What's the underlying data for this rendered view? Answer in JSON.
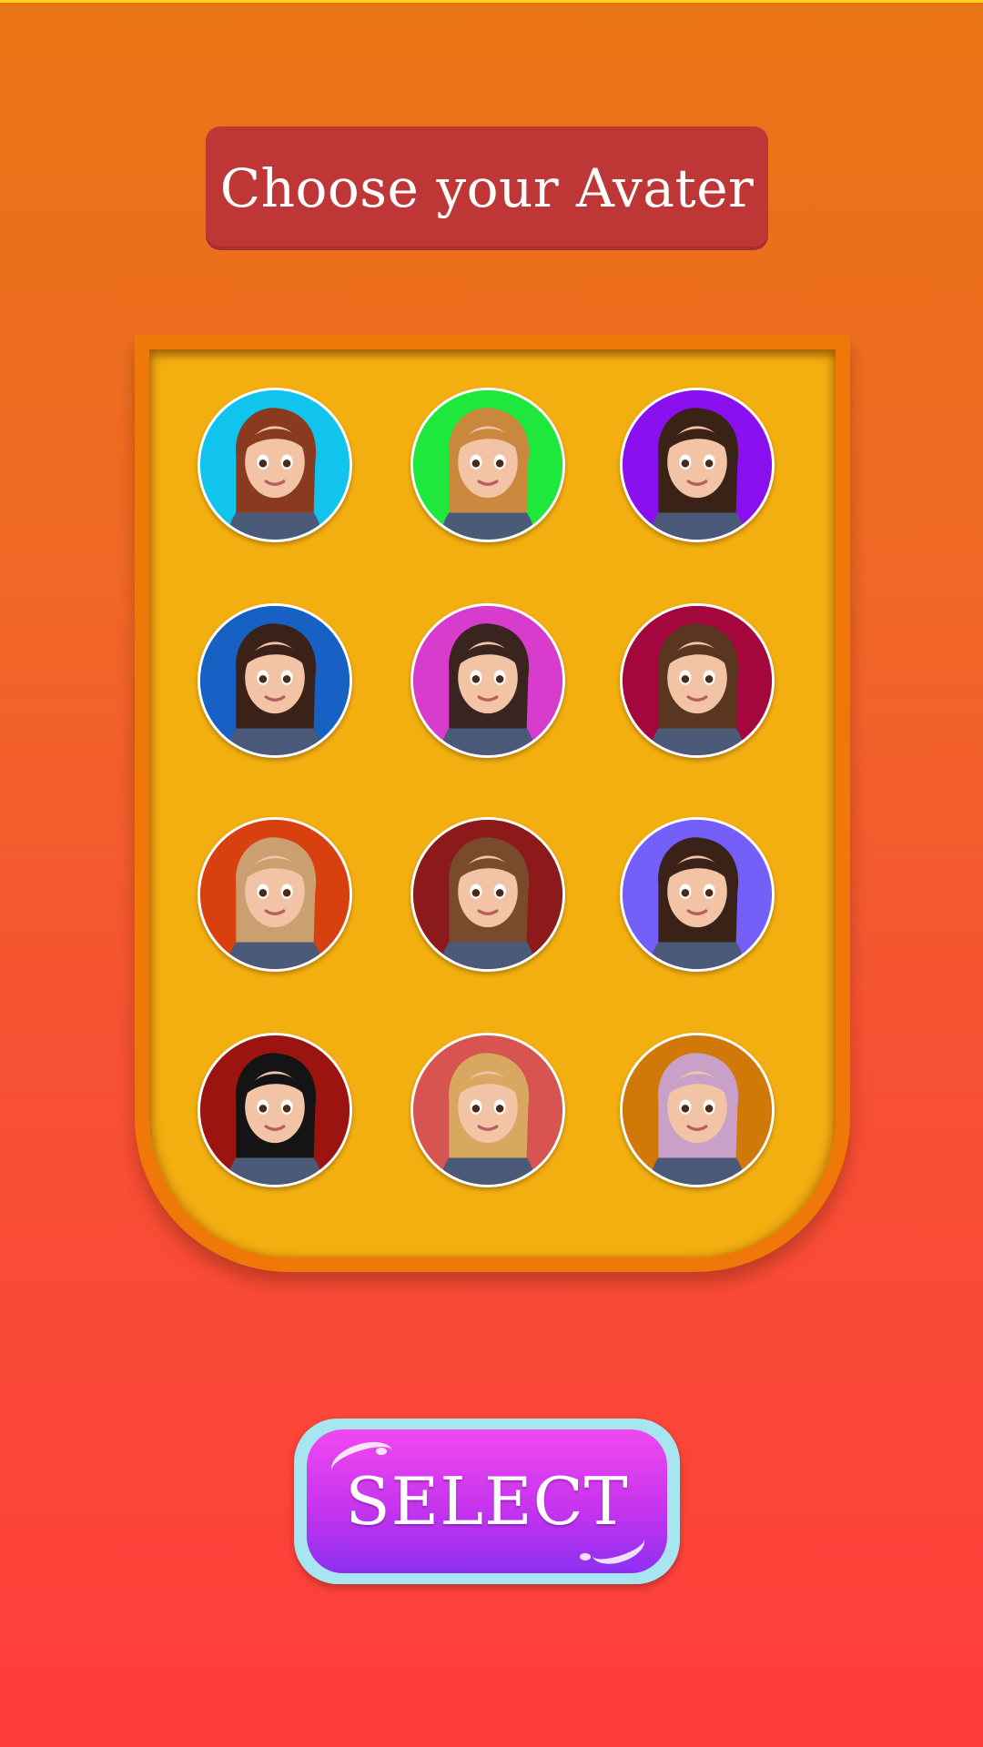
{
  "header": {
    "title": "Choose your Avater"
  },
  "avatars": [
    {
      "icon": "avatar-girl-pink-cap-icon",
      "background": "#10c4ee"
    },
    {
      "icon": "avatar-girl-blonde-icon",
      "background": "#1ee83c"
    },
    {
      "icon": "avatar-man-dark-hair-icon",
      "background": "#8a10f0"
    },
    {
      "icon": "avatar-girl-brown-hair-icon",
      "background": "#1760c4"
    },
    {
      "icon": "avatar-girl-scarf-icon",
      "background": "#d83ccc"
    },
    {
      "icon": "avatar-girl-glasses-icon",
      "background": "#a4063e"
    },
    {
      "icon": "avatar-girl-light-hair-icon",
      "background": "#d84010"
    },
    {
      "icon": "avatar-girl-wavy-hair-icon",
      "background": "#8c1a1a"
    },
    {
      "icon": "avatar-girl-pigtails-icon",
      "background": "#7460f8"
    },
    {
      "icon": "avatar-girl-black-hair-icon",
      "background": "#9c1410"
    },
    {
      "icon": "avatar-girl-blonde-denim-icon",
      "background": "#d85450"
    },
    {
      "icon": "avatar-girl-pink-hair-icon",
      "background": "#d07808"
    }
  ],
  "footer": {
    "select_label": "SELECT"
  }
}
